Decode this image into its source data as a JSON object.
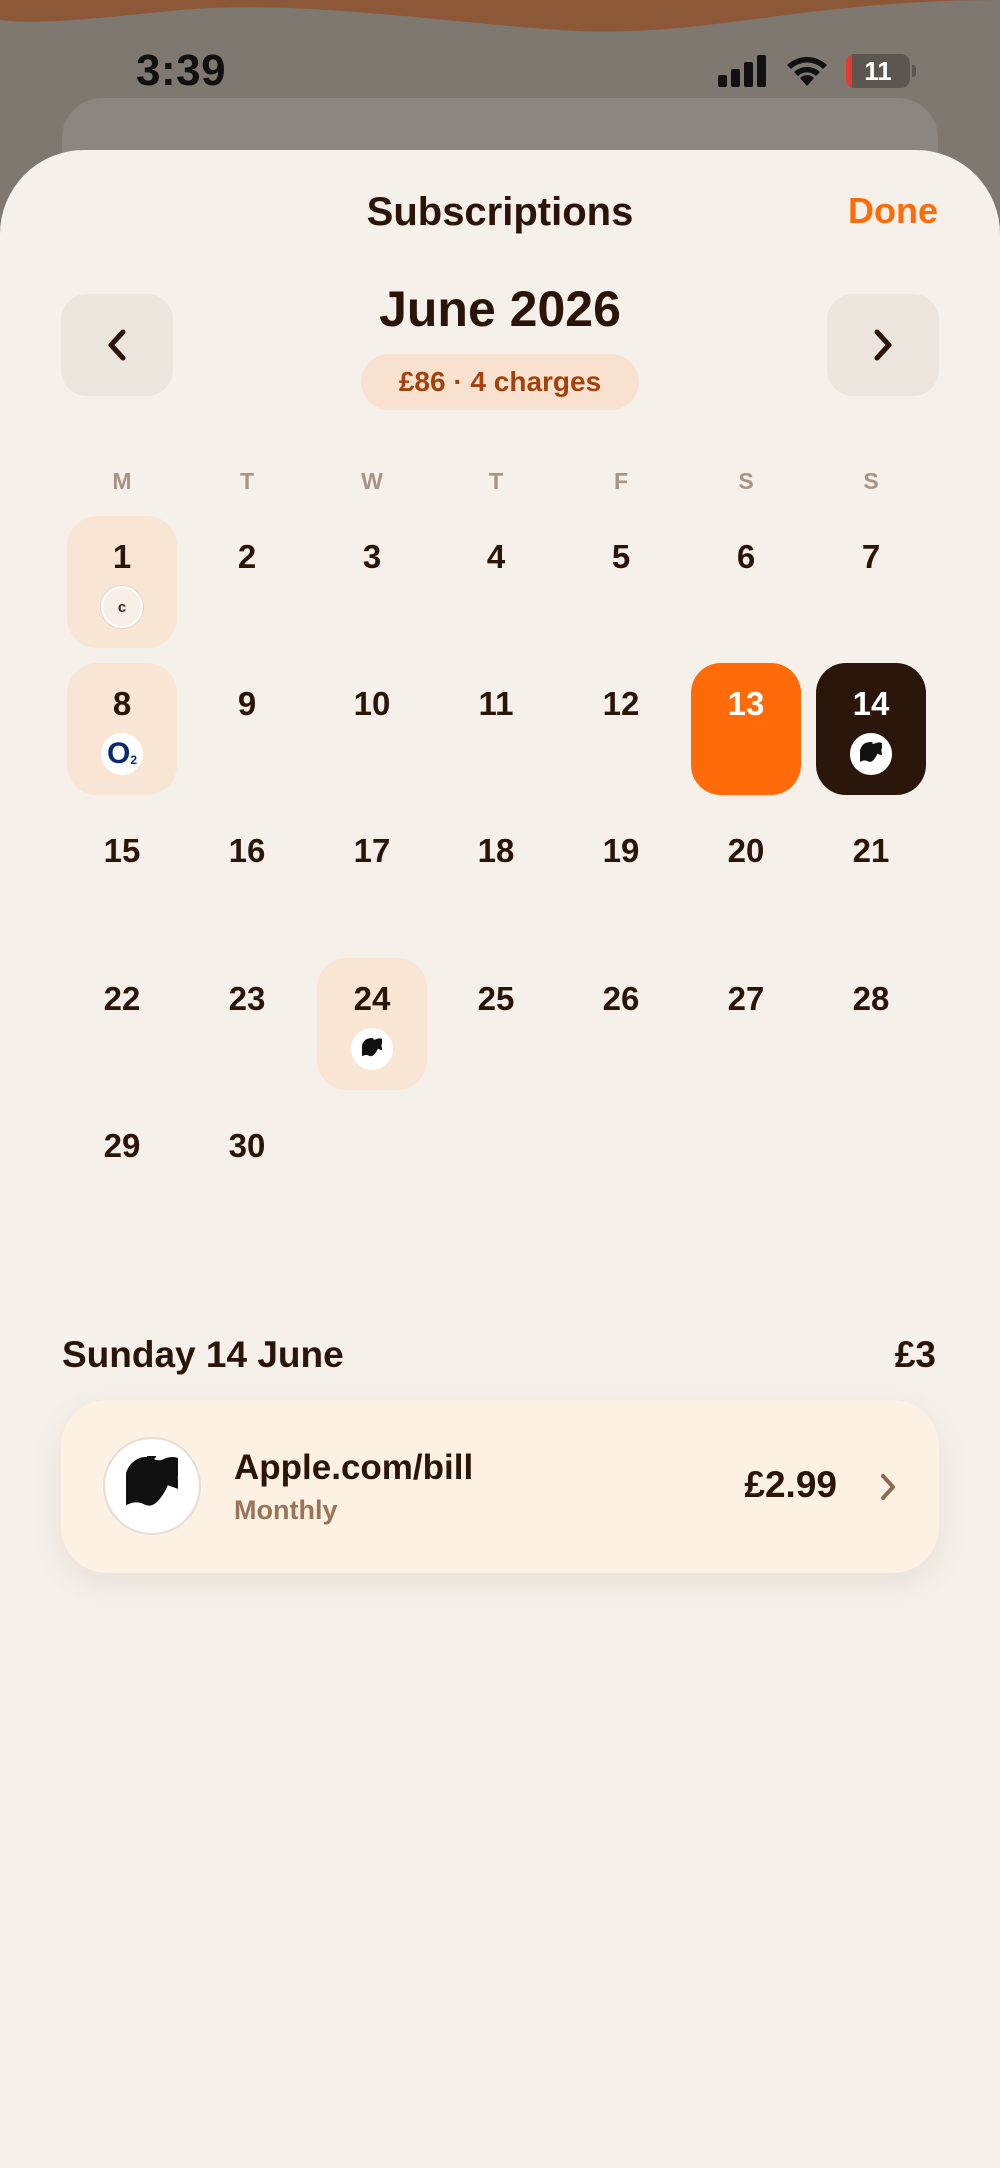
{
  "status_bar": {
    "time": "3:39",
    "battery": "11"
  },
  "header": {
    "title": "Subscriptions",
    "done_label": "Done"
  },
  "month_nav": {
    "month_label": "June 2026",
    "summary": "£86 · 4 charges",
    "prev_icon": "chevron-left-icon",
    "next_icon": "chevron-right-icon"
  },
  "calendar": {
    "weekdays": [
      "M",
      "T",
      "W",
      "T",
      "F",
      "S",
      "S"
    ],
    "days": [
      "1",
      "2",
      "3",
      "4",
      "5",
      "6",
      "7",
      "8",
      "9",
      "10",
      "11",
      "12",
      "13",
      "14",
      "15",
      "16",
      "17",
      "18",
      "19",
      "20",
      "21",
      "22",
      "23",
      "24",
      "25",
      "26",
      "27",
      "28",
      "29",
      "30"
    ],
    "logo_letter_day1": "c",
    "logo_o2_text": "O",
    "logo_o2_sub": "2",
    "charge_days": [
      1,
      8,
      14,
      24
    ],
    "today": 13,
    "selected": 14
  },
  "selected_day": {
    "title": "Sunday 14 June",
    "total": "£3",
    "items": [
      {
        "name": "Apple.com/bill",
        "frequency": "Monthly",
        "price": "£2.99",
        "icon": "apple-icon"
      }
    ]
  },
  "colors": {
    "accent": "#ff6b08",
    "dark": "#2a160b",
    "charge_bg": "#f8e5d4",
    "sheet_bg": "#f5f0ea"
  }
}
